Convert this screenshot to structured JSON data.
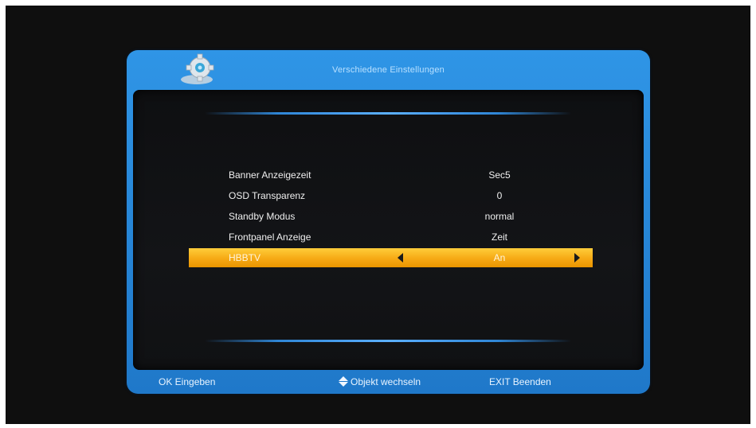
{
  "dialog": {
    "title": "Verschiedene Einstellungen",
    "header_icon": "gear-icon"
  },
  "menu": {
    "items": [
      {
        "label": "Banner Anzeigezeit",
        "value": "Sec5"
      },
      {
        "label": "OSD Transparenz",
        "value": "0"
      },
      {
        "label": "Standby Modus",
        "value": "normal"
      },
      {
        "label": "Frontpanel Anzeige",
        "value": "Zeit"
      },
      {
        "label": "HBBTV",
        "value": "An"
      }
    ],
    "selected_index": 4
  },
  "footer": {
    "ok_label": "OK Eingeben",
    "move_label": "Objekt wechseln",
    "move_icon": "up-down-arrows-icon",
    "exit_label": "EXIT Beenden"
  },
  "colors": {
    "frame_blue": "#2f95e6",
    "highlight": "#f6a914",
    "background": "#0f0f0f"
  }
}
